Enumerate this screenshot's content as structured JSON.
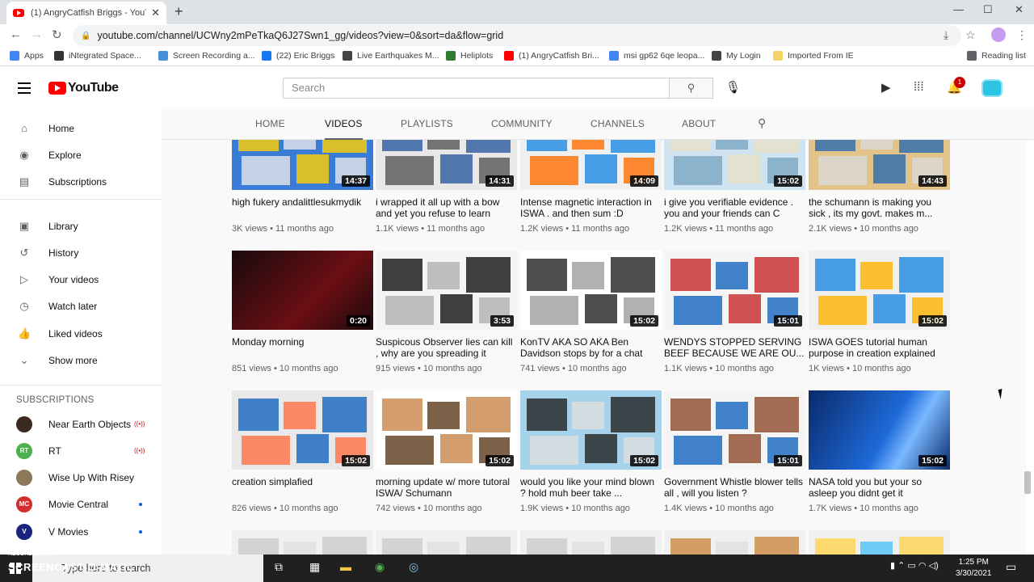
{
  "browser": {
    "tab_title": "(1) AngryCatfish Briggs - YouTube",
    "url": "youtube.com/channel/UCWny2mPeTkaQ6J27Swn1_gg/videos?view=0&sort=da&flow=grid",
    "bookmarks": [
      {
        "label": "Apps",
        "color": "#4285f4"
      },
      {
        "label": "iNtegrated Space...",
        "color": "#333333"
      },
      {
        "label": "Screen Recording a...",
        "color": "#4a90d9"
      },
      {
        "label": "(22) Eric Briggs",
        "color": "#1877f2"
      },
      {
        "label": "Live Earthquakes M...",
        "color": "#444444"
      },
      {
        "label": "Heliplots",
        "color": "#2e7d32"
      },
      {
        "label": "(1) AngryCatfish Bri...",
        "color": "#ff0000"
      },
      {
        "label": "msi gp62 6qe leopa...",
        "color": "#4285f4"
      },
      {
        "label": "My Login",
        "color": "#444444"
      },
      {
        "label": "Imported From IE",
        "color": "#f6d365"
      },
      {
        "label": "Reading list",
        "color": "#5f6368"
      }
    ]
  },
  "header": {
    "logo_text": "YouTube",
    "search_placeholder": "Search",
    "notification_count": "1"
  },
  "sidebar": {
    "main": [
      {
        "label": "Home",
        "icon": "home-icon",
        "glyph": "⌂"
      },
      {
        "label": "Explore",
        "icon": "compass-icon",
        "glyph": "◉"
      },
      {
        "label": "Subscriptions",
        "icon": "subscriptions-icon",
        "glyph": "▤"
      }
    ],
    "library": [
      {
        "label": "Library",
        "icon": "library-icon",
        "glyph": "▣"
      },
      {
        "label": "History",
        "icon": "history-icon",
        "glyph": "↺"
      },
      {
        "label": "Your videos",
        "icon": "your-videos-icon",
        "glyph": "▷"
      },
      {
        "label": "Watch later",
        "icon": "clock-icon",
        "glyph": "◷"
      },
      {
        "label": "Liked videos",
        "icon": "thumbs-up-icon",
        "glyph": "👍"
      },
      {
        "label": "Show more",
        "icon": "chevron-down-icon",
        "glyph": "⌄"
      }
    ],
    "subscriptions_heading": "SUBSCRIPTIONS",
    "subscriptions": [
      {
        "label": "Near Earth Objects",
        "avatar_color": "#3a2a20",
        "avatar_text": "",
        "status": "live"
      },
      {
        "label": "RT",
        "avatar_color": "#4caf50",
        "avatar_text": "RT",
        "status": "live"
      },
      {
        "label": "Wise Up With Risey",
        "avatar_color": "#8a7a5a",
        "avatar_text": "",
        "status": ""
      },
      {
        "label": "Movie Central",
        "avatar_color": "#d32f2f",
        "avatar_text": "MC",
        "status": "new"
      },
      {
        "label": "V Movies",
        "avatar_color": "#1a237e",
        "avatar_text": "V",
        "status": "new"
      }
    ]
  },
  "channel_tabs": [
    "HOME",
    "VIDEOS",
    "PLAYLISTS",
    "COMMUNITY",
    "CHANNELS",
    "ABOUT"
  ],
  "active_tab": "VIDEOS",
  "videos": [
    {
      "title": "high fukery andalittlesukmydik",
      "duration": "14:37",
      "meta": "3K views • 11 months ago",
      "palette": [
        "#3a7bd5",
        "#ffd200",
        "#e9e9e9"
      ]
    },
    {
      "title": "i wrapped it all up with a bow and yet you refuse to learn",
      "duration": "14:31",
      "meta": "1.1K views • 11 months ago",
      "palette": [
        "#e8e8e8",
        "#2c5aa0",
        "#555555"
      ]
    },
    {
      "title": "Intense magnetic interaction in ISWA . and then sum :D",
      "duration": "14:09",
      "meta": "1.2K views • 11 months ago",
      "palette": [
        "#f0f0f0",
        "#1e88e5",
        "#ff6f00"
      ]
    },
    {
      "title": "i give you verifiable evidence . you and your friends can C",
      "duration": "15:02",
      "meta": "1.2K views • 11 months ago",
      "palette": [
        "#cfe3f0",
        "#e8e0c8",
        "#7aa6c2"
      ]
    },
    {
      "title": "the schumann is making you sick , its my govt. makes m...",
      "duration": "14:43",
      "meta": "2.1K views • 10 months ago",
      "palette": [
        "#e2c48a",
        "#2b6cb0",
        "#d9d9d9"
      ]
    },
    {
      "title": "Monday morning",
      "duration": "0:20",
      "meta": "851 views • 10 months ago",
      "palette": [
        "#1a0a0c",
        "#6b0f14",
        "#b3141c"
      ]
    },
    {
      "title": "Suspicous Observer lies can kill , why are you spreading it",
      "duration": "3:53",
      "meta": "915 views • 10 months ago",
      "palette": [
        "#f4f4f4",
        "#111111",
        "#b0b0b0"
      ]
    },
    {
      "title": "KonTV AKA SO AKA Ben Davidson stops by for a chat",
      "duration": "15:02",
      "meta": "741 views • 10 months ago",
      "palette": [
        "#ffffff",
        "#222222",
        "#9e9e9e"
      ]
    },
    {
      "title": "WENDYS STOPPED SERVING BEEF BECAUSE WE ARE OU...",
      "duration": "15:01",
      "meta": "1.1K views • 10 months ago",
      "palette": [
        "#f5f5f5",
        "#c62828",
        "#1565c0"
      ]
    },
    {
      "title": "ISWA GOES tutorial human purpose in creation explained",
      "duration": "15:02",
      "meta": "1K views • 10 months ago",
      "palette": [
        "#f0f0f0",
        "#1e88e5",
        "#ffb300"
      ]
    },
    {
      "title": "creation simplafied",
      "duration": "15:02",
      "meta": "826 views • 10 months ago",
      "palette": [
        "#e8e8e8",
        "#1565c0",
        "#ff7043"
      ]
    },
    {
      "title": "morning update w/ more tutoral ISWA/ Schumann",
      "duration": "15:02",
      "meta": "742 views • 10 months ago",
      "palette": [
        "#ffffff",
        "#c8844a",
        "#5d3a1a"
      ]
    },
    {
      "title": "would you like your mind blown ? hold muh beer take ...",
      "duration": "15:02",
      "meta": "1.9K views • 10 months ago",
      "palette": [
        "#a7d3ea",
        "#222222",
        "#e0e0e0"
      ]
    },
    {
      "title": "Government Whistle blower tells all , will you listen ?",
      "duration": "15:01",
      "meta": "1.4K views • 10 months ago",
      "palette": [
        "#f5f5f5",
        "#8d4a2a",
        "#1565c0"
      ]
    },
    {
      "title": "NASA told you but your so asleep you didnt get it",
      "duration": "15:02",
      "meta": "1.7K views • 10 months ago",
      "palette": [
        "#0a2a6a",
        "#1e6ad9",
        "#7ab8ff"
      ]
    },
    {
      "title": "",
      "duration": "",
      "meta": "",
      "palette": [
        "#f0f0f0",
        "#cccccc",
        "#e0e0e0"
      ]
    },
    {
      "title": "",
      "duration": "",
      "meta": "",
      "palette": [
        "#f0f0f0",
        "#cccccc",
        "#e0e0e0"
      ]
    },
    {
      "title": "",
      "duration": "",
      "meta": "",
      "palette": [
        "#f0f0f0",
        "#cccccc",
        "#e0e0e0"
      ]
    },
    {
      "title": "",
      "duration": "",
      "meta": "",
      "palette": [
        "#f0f0f0",
        "#cc8844",
        "#e0e0e0"
      ]
    },
    {
      "title": "",
      "duration": "",
      "meta": "",
      "palette": [
        "#f0f0f0",
        "#ffd54f",
        "#4fc3f7"
      ]
    }
  ],
  "taskbar": {
    "search_text": "Type here to search",
    "time": "1:25 PM",
    "date": "3/30/2021",
    "watermark_top": "RECORDED WITH",
    "watermark_main": "SCREENCAST-O-MATIC"
  }
}
